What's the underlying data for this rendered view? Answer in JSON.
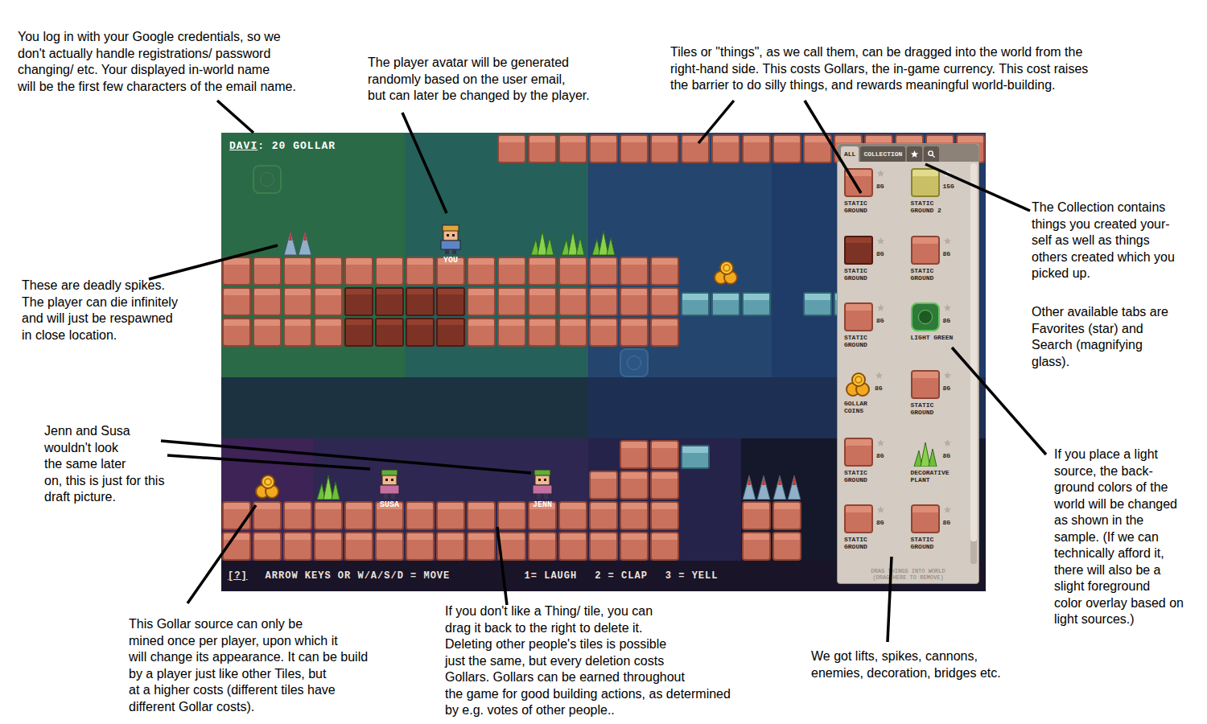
{
  "hud": {
    "name": "DAVI",
    "balance": ": 20 GOLLAR"
  },
  "players": [
    {
      "label": "YOU",
      "color": "#5b86c4",
      "hair_color": "#e3a53a"
    },
    {
      "label": "SUSA",
      "color": "#c46fa0",
      "hair_color": "#5fae3c"
    },
    {
      "label": "JENN",
      "color": "#c46fa0",
      "hair_color": "#5fae3c"
    }
  ],
  "help_bar": {
    "help": "[?]",
    "hints": [
      "ARROW KEYS OR W/A/S/D = MOVE",
      "1= LAUGH",
      "2 = CLAP",
      "3 = YELL"
    ]
  },
  "things_panel": {
    "tabs": [
      {
        "kind": "text",
        "label": "ALL",
        "selected": true
      },
      {
        "kind": "text",
        "label": "COLLECTION",
        "selected": false
      },
      {
        "kind": "star",
        "label": "",
        "selected": false
      },
      {
        "kind": "search",
        "label": "",
        "selected": false
      }
    ],
    "items": [
      {
        "name": "STATIC GROUND",
        "cost": "8G",
        "kind": "ground",
        "favorite": false
      },
      {
        "name": "STATIC GROUND 2",
        "cost": "15G",
        "kind": "ground2",
        "favorite": true
      },
      {
        "name": "STATIC GROUND",
        "cost": "8G",
        "kind": "dark",
        "favorite": false
      },
      {
        "name": "STATIC GROUND",
        "cost": "8G",
        "kind": "ground",
        "favorite": false
      },
      {
        "name": "STATIC GROUND",
        "cost": "8G",
        "kind": "ground",
        "favorite": false
      },
      {
        "name": "LIGHT GREEN",
        "cost": "8G",
        "kind": "light",
        "favorite": false
      },
      {
        "name": "GOLLAR COINS",
        "cost": "8G",
        "kind": "coins",
        "favorite": false
      },
      {
        "name": "STATIC GROUND",
        "cost": "8G",
        "kind": "ground",
        "favorite": false
      },
      {
        "name": "STATIC GROUND",
        "cost": "8G",
        "kind": "ground",
        "favorite": false
      },
      {
        "name": "DECORATIVE PLANT",
        "cost": "8G",
        "kind": "plant",
        "favorite": false
      },
      {
        "name": "STATIC GROUND",
        "cost": "8G",
        "kind": "ground",
        "favorite": false
      },
      {
        "name": "STATIC GROUND",
        "cost": "8G",
        "kind": "ground",
        "favorite": false
      }
    ],
    "footer": [
      "DRAG THINGS INTO WORLD",
      "(DRAG HERE TO REMOVE)"
    ]
  },
  "annotations": [
    {
      "lines": [
        "You log in with your Google credentials, so we",
        "don't actually handle registrations/ password",
        "changing/ etc. Your displayed in-world name",
        "will be the first few characters of the email name."
      ]
    },
    {
      "lines": [
        "The player avatar will be generated",
        "randomly based on the user email,",
        "but can later be changed by the player."
      ]
    },
    {
      "lines": [
        "Tiles or \"things\", as we call them, can be dragged into the world from the",
        "right-hand side. This costs Gollars, the in-game currency. This cost raises",
        "the barrier to do silly things, and rewards meaningful world-building."
      ]
    },
    {
      "lines": [
        "The Collection contains",
        "things you created your-",
        "self as well as things",
        "others created which you",
        "picked up."
      ]
    },
    {
      "lines": [
        "Other available tabs are",
        "Favorites (star) and",
        "Search (magnifying",
        "glass)."
      ]
    },
    {
      "lines": [
        "These are deadly spikes.",
        "The player can die infinitely",
        "and will just be respawned",
        "in close location."
      ]
    },
    {
      "lines": [
        "Jenn and Susa",
        "wouldn't look",
        "the same later",
        "on, this is just for this",
        "draft picture."
      ]
    },
    {
      "lines": [
        "If you place a light",
        "source, the back-",
        "ground colors of the",
        "world will be changed",
        "as shown in the",
        "sample. (If we can",
        "technically afford it,",
        "there will also be a",
        "slight foreground",
        "color overlay based on",
        "light sources.)"
      ]
    },
    {
      "lines": [
        "This Gollar source can only be",
        "mined once per player, upon which it",
        "will change its appearance. It can be build",
        "by a player just like other Tiles, but",
        "at a higher costs (different tiles have",
        "different Gollar costs)."
      ]
    },
    {
      "lines": [
        "If you don't like a Thing/ tile, you can",
        "drag it back to the right to delete it.",
        "Deleting other people's tiles is possible",
        "just the same, but every deletion costs",
        "Gollars. Gollars can be earned throughout",
        "the game for good building actions, as determined",
        "by e.g. votes of other people.."
      ]
    },
    {
      "lines": [
        "We got lifts, spikes, cannons,",
        "enemies, decoration, bridges etc."
      ]
    }
  ]
}
